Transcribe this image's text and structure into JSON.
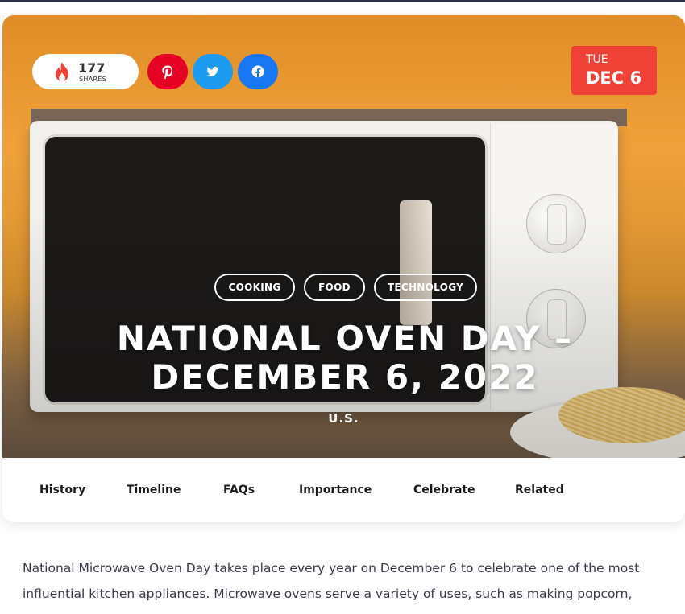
{
  "share": {
    "count": "177",
    "label": "SHARES"
  },
  "social": [
    "pinterest-icon",
    "twitter-icon",
    "facebook-icon"
  ],
  "date": {
    "weekday": "TUE",
    "day": "DEC 6"
  },
  "tags": [
    "COOKING",
    "FOOD",
    "TECHNOLOGY"
  ],
  "title_line1": "NATIONAL OVEN DAY –",
  "title_line2": "DECEMBER 6, 2022",
  "country": "U.S.",
  "nav": [
    "History",
    "Timeline",
    "FAQs",
    "Importance",
    "Celebrate",
    "Related"
  ],
  "body": {
    "line1": "National Microwave Oven Day takes place every year on December 6 to celebrate one of the most",
    "line2": "influential kitchen appliances. Microwave ovens serve a variety of uses, such as making popcorn,"
  },
  "colors": {
    "date_badge": "#ef4136",
    "pinterest": "#e60023",
    "twitter": "#1d9bf0",
    "facebook": "#1877f2",
    "nav_bar_top": "#2c3346"
  }
}
